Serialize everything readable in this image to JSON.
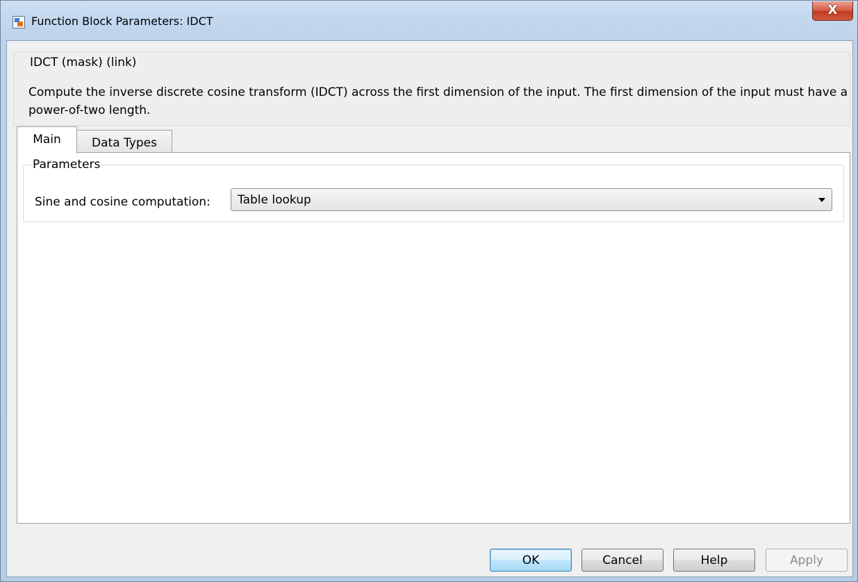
{
  "window": {
    "title": "Function Block Parameters: IDCT",
    "icon": "simulink-block-icon",
    "close_label": "X"
  },
  "description": {
    "legend": "IDCT (mask) (link)",
    "text": "Compute the inverse discrete cosine transform (IDCT) across the first dimension of the input. The first dimension of the input must have a power-of-two length."
  },
  "tabs": [
    {
      "label": "Main",
      "active": true
    },
    {
      "label": "Data Types",
      "active": false
    }
  ],
  "parameters": {
    "legend": "Parameters",
    "sine_cosine_label": "Sine and cosine computation:",
    "sine_cosine_value": "Table lookup"
  },
  "buttons": {
    "ok": "OK",
    "cancel": "Cancel",
    "help": "Help",
    "apply": "Apply"
  },
  "colors": {
    "default_button_border": "#3c7fb1",
    "close_button": "#c23b21",
    "title_bar": "#c5d9ef"
  }
}
